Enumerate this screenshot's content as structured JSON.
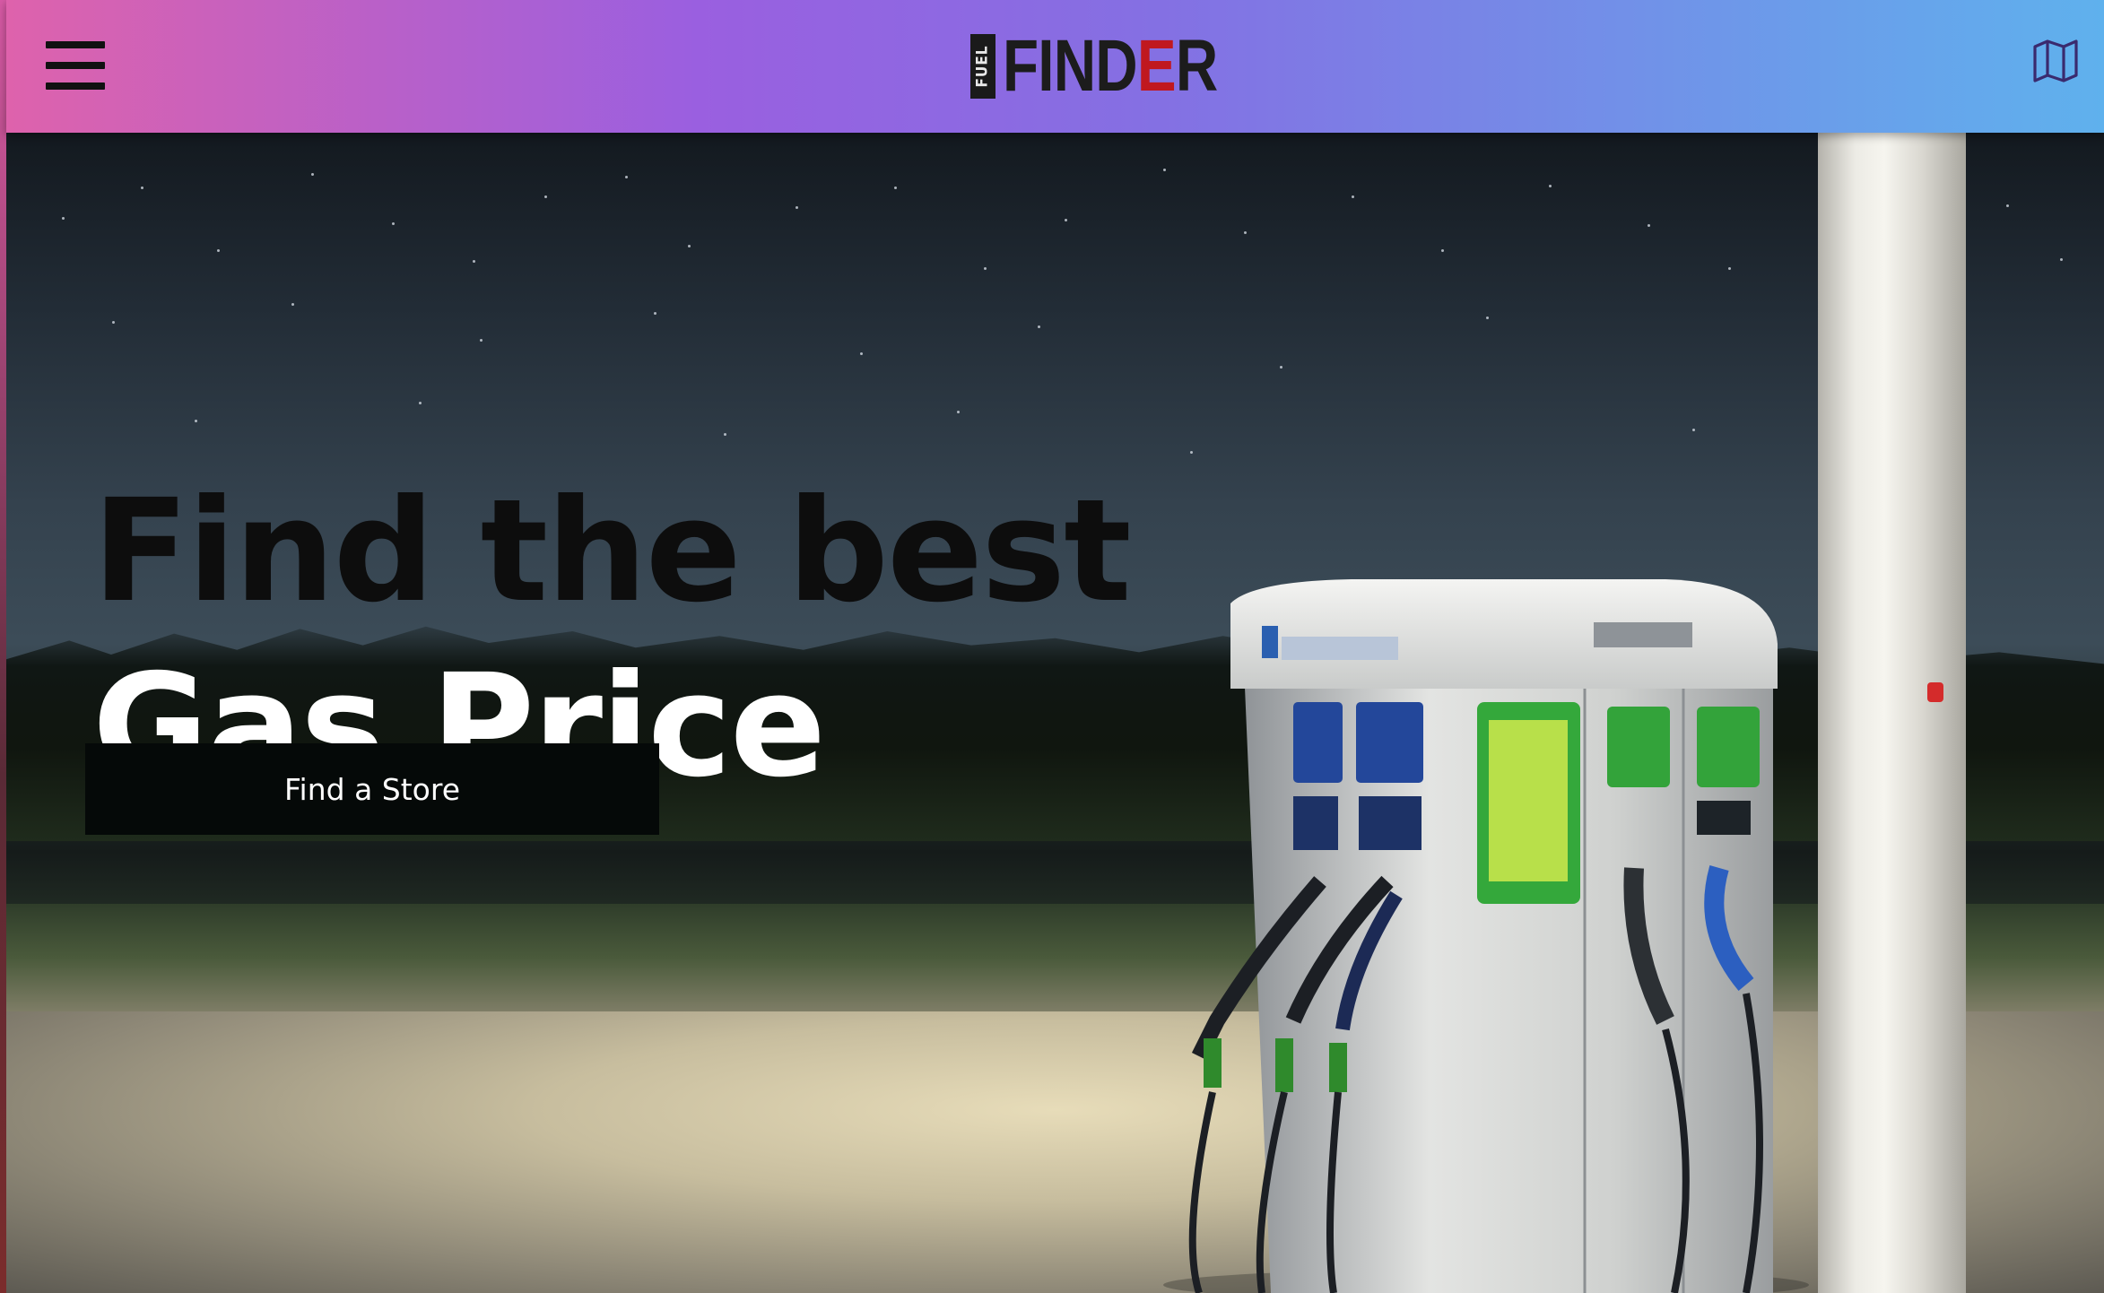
{
  "header": {
    "logo_small": "FUEL",
    "logo_main_prefix": "FIND",
    "logo_main_accent": "E",
    "logo_main_suffix": "R",
    "menu_icon": "hamburger-menu-icon",
    "map_icon": "map-icon"
  },
  "hero": {
    "title_line1": "Find the best",
    "title_line2": "Gas Price",
    "cta_label": "Find a Store",
    "background_image": "fuel-pump-at-night-photo"
  },
  "colors": {
    "nav_gradient_start": "#de62ac",
    "nav_gradient_mid": "#9a5fe0",
    "nav_gradient_end": "#5fb1ed",
    "logo_accent": "#c0181f",
    "cta_background": "#050908",
    "cta_text": "#ffffff"
  }
}
